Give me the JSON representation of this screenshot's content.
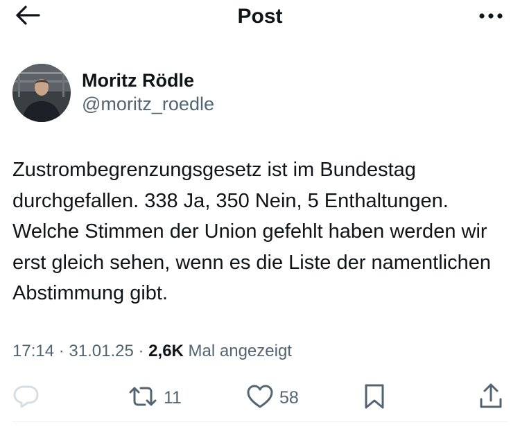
{
  "header": {
    "title": "Post",
    "icons": {
      "back": "arrow-left-icon",
      "more": "more-horizontal-icon"
    }
  },
  "author": {
    "name": "Moritz Rödle",
    "handle": "@moritz_roedle"
  },
  "post": {
    "text": "Zustrombegrenzungsgesetz ist im Bundestag durchgefallen. 338 Ja, 350 Nein, 5 Enthaltungen. Welche Stimmen der Union gefehlt haben werden wir erst gleich sehen, wenn es die Liste der namentlichen Abstimmung gibt.",
    "time": "17:14",
    "date": "31.01.25",
    "views": "2,6K",
    "views_label": "Mal angezeigt"
  },
  "actions": {
    "reply": {
      "icon": "reply-icon"
    },
    "repost": {
      "icon": "repost-icon",
      "count": "11"
    },
    "like": {
      "icon": "heart-icon",
      "count": "58"
    },
    "bookmark": {
      "icon": "bookmark-icon"
    },
    "share": {
      "icon": "share-icon"
    }
  },
  "colors": {
    "text_primary": "#0f1419",
    "text_secondary": "#536471",
    "reply_icon_faded": "#d7dde1",
    "divider": "#eff3f4"
  }
}
